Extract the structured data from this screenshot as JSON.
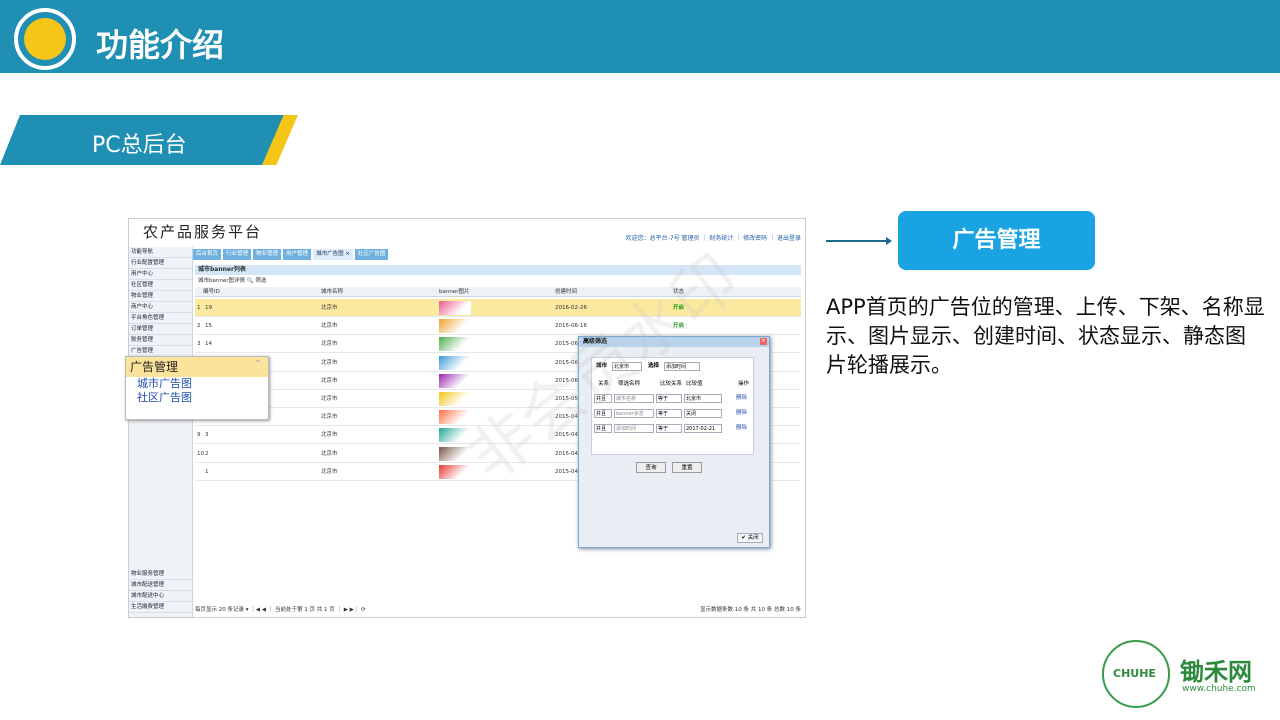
{
  "header": {
    "title": "功能介绍"
  },
  "section": {
    "label": "PC总后台"
  },
  "screenshot": {
    "site_name": "农产品服务平台",
    "top_links": "欢迎您：总平台-7号 管理员 ｜ 财务统计 ｜ 修改密码 ｜ 退出登录",
    "sidebar_items": [
      "功能导航",
      "行业配置管理",
      "用户中心",
      "社区管理",
      "物业管理",
      "商户中心",
      "平台角色管理",
      "订单管理",
      "账务管理",
      "广告管理"
    ],
    "sidebar_bottom": [
      "物业服务管理",
      "城市配送管理",
      "城市配送中心",
      "生活缴费管理"
    ],
    "tabs": [
      "后台首页",
      "行业管理",
      "物业管理",
      "用户管理",
      "城市广告图 ×",
      "社区广告图"
    ],
    "panel_title": "城市banner列表",
    "toolbar": "城市banner图详情  🔍 筛选",
    "columns": [
      "编号ID",
      "城市名称",
      "banner图片",
      "创建时间",
      "状态"
    ],
    "rows": [
      {
        "idx": "1",
        "id": "19",
        "city": "北京市",
        "date": "2016-02-26",
        "status": "开启"
      },
      {
        "idx": "2",
        "id": "15",
        "city": "北京市",
        "date": "2015-06-16",
        "status": "开启"
      },
      {
        "idx": "3",
        "id": "14",
        "city": "北京市",
        "date": "2015-06-11",
        "status": ""
      },
      {
        "idx": "",
        "id": "",
        "city": "北京市",
        "date": "2015-06-11",
        "status": ""
      },
      {
        "idx": "",
        "id": "",
        "city": "北京市",
        "date": "2015-06-11",
        "status": ""
      },
      {
        "idx": "",
        "id": "",
        "city": "北京市",
        "date": "2015-05-11",
        "status": ""
      },
      {
        "idx": "",
        "id": "",
        "city": "北京市",
        "date": "2015-04-30",
        "status": ""
      },
      {
        "idx": "9",
        "id": "3",
        "city": "北京市",
        "date": "2015-04-30",
        "status": ""
      },
      {
        "idx": "10",
        "id": "2",
        "city": "北京市",
        "date": "2015-04-30",
        "status": ""
      },
      {
        "idx": "",
        "id": "1",
        "city": "北京市",
        "date": "2015-04-30",
        "status": ""
      }
    ],
    "pager_left": "每页显示 20 条记录  ▾  ｜◀ ◀ ｜ 当前处于第 1 页 共 1 页 ｜ ▶ ▶｜ ⟳",
    "pager_right": "显示数据条数 10 条 共 10 条 总数 10 条",
    "ad_dropdown": {
      "title": "广告管理",
      "items": [
        "城市广告图",
        "社区广告图"
      ]
    },
    "dialog": {
      "title": "高级筛选",
      "city_label": "城市",
      "city_value": "北京市",
      "select_label": "选择",
      "select_value": "添加时间",
      "cols": [
        "关系",
        "筛选名称",
        "比较关系",
        "比较值",
        "操作"
      ],
      "rows": [
        {
          "rel": "并且",
          "name": "城市名称",
          "cmp": "等于",
          "val": "北京市",
          "op": "删除"
        },
        {
          "rel": "并且",
          "name": "banner状态",
          "cmp": "等于",
          "val": "关闭",
          "op": "删除"
        },
        {
          "rel": "并且",
          "name": "添加时间",
          "cmp": "等于",
          "val": "2017-02-21",
          "op": "删除"
        }
      ],
      "query": "查询",
      "reset": "重置",
      "close": "✔ 关闭"
    }
  },
  "ad_button": "广告管理",
  "description": "APP首页的广告位的管理、上传、下架、名称显示、图片显示、创建时间、状态显示、静态图片轮播展示。",
  "watermark": "非会员水印",
  "logo": {
    "badge": "CHUHE",
    "brand": "锄禾网",
    "url": "www.chuhe.com"
  },
  "colors": {
    "banner": "#1f8fb3",
    "accent": "#f5c518",
    "button": "#1aa3e3",
    "brand_green": "#2d8a3d"
  }
}
